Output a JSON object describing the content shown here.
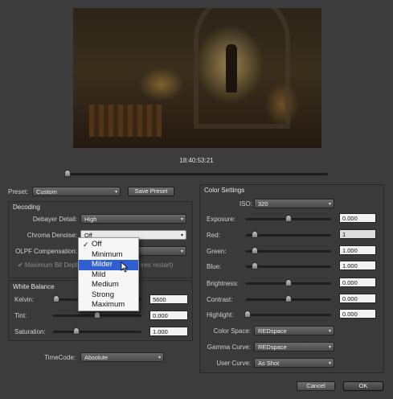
{
  "preview": {
    "timecode": "18:40:53:21"
  },
  "preset": {
    "label": "Preset:",
    "value": "Custom",
    "save_button": "Save Preset"
  },
  "decoding": {
    "title": "Decoding",
    "debayer_label": "Debayer Detail:",
    "debayer_value": "High",
    "chroma_label": "Chroma Denoise:",
    "chroma_value": "Off",
    "olpf_label": "OLPF Compensation:",
    "max_bit_label": "Maximum Bit Depth",
    "restart_note": "(requires restart)",
    "max_bit_visible": "✔ Maximum Bit Depth",
    "restart_visible": "ires restart)"
  },
  "chroma_menu": {
    "items": [
      "Off",
      "Minimum",
      "Milder",
      "Mild",
      "Medium",
      "Strong",
      "Maximum"
    ],
    "checked": "Off",
    "highlighted": "Milder",
    "check_glyph": "✓"
  },
  "white_balance": {
    "title": "White Balance",
    "kelvin_label": "Kelvin:",
    "kelvin_value": "5600",
    "tint_label": "Tint:",
    "tint_value": "0.000",
    "saturation_label": "Saturation:",
    "saturation_value": "1.000"
  },
  "timecode_row": {
    "label": "TimeCode:",
    "value": "Absolute"
  },
  "color_settings": {
    "title": "Color Settings",
    "iso_label": "ISO:",
    "iso_value": "320",
    "exposure_label": "Exposure:",
    "exposure_value": "0.000",
    "red_label": "Red:",
    "red_value": "1",
    "green_label": "Green:",
    "green_value": "1.000",
    "blue_label": "Blue:",
    "blue_value": "1.000",
    "brightness_label": "Brightness:",
    "brightness_value": "0.000",
    "contrast_label": "Contrast:",
    "contrast_value": "0.000",
    "highlight_label": "Highlight:",
    "highlight_value": "0.000",
    "color_space_label": "Color Space:",
    "color_space_value": "REDspace",
    "gamma_label": "Gamma Curve:",
    "gamma_value": "REDspace",
    "user_curve_label": "User Curve:",
    "user_curve_value": "As Shot"
  },
  "footer": {
    "cancel": "Cancel",
    "ok": "OK"
  },
  "icons": {
    "dropdown": "▾",
    "cursor": "pointer-arrow-icon"
  },
  "colors": {
    "menu_highlight": "#2f5fd0",
    "background": "#3c3c3c"
  }
}
